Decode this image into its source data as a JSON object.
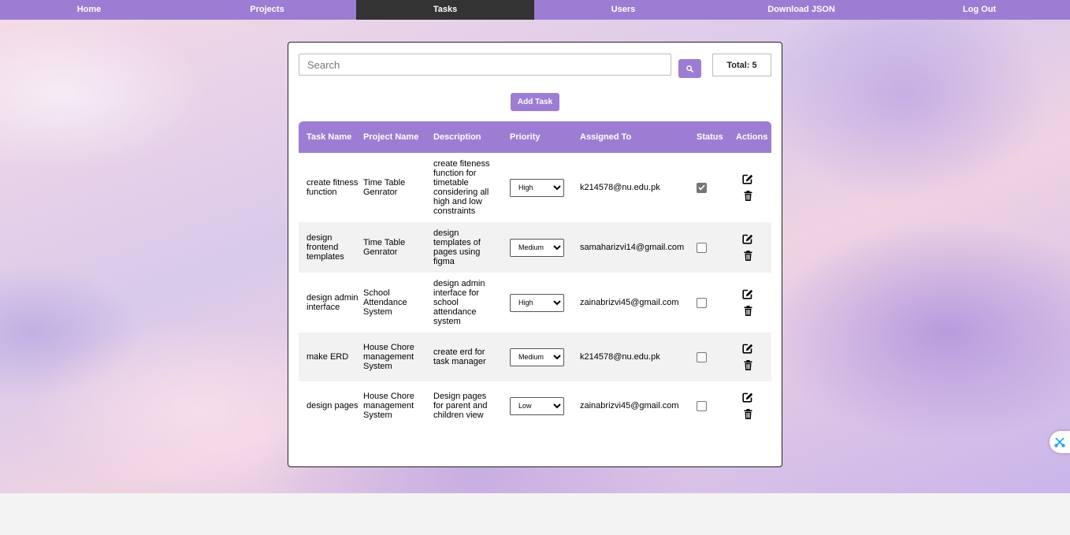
{
  "nav": [
    "Home",
    "Projects",
    "Tasks",
    "Users",
    "Download JSON",
    "Log Out"
  ],
  "nav_active": "Tasks",
  "search": {
    "placeholder": "Search",
    "value": ""
  },
  "total_label": "Total: 5",
  "add_task_label": "Add Task",
  "columns": [
    "Task Name",
    "Project Name",
    "Description",
    "Priority",
    "Assigned To",
    "Status",
    "Actions"
  ],
  "priority_options": [
    "High",
    "Medium",
    "Low"
  ],
  "tasks": [
    {
      "task": "create fitness function",
      "project": "Time Table Genrator",
      "description": "create fiteness function for timetable considering all high and low constraints",
      "priority": "High",
      "assigned": "k214578@nu.edu.pk",
      "done": true
    },
    {
      "task": "design frontend templates",
      "project": "Time Table Genrator",
      "description": "design templates of pages using figma",
      "priority": "Medium",
      "assigned": "samaharizvi14@gmail.com",
      "done": false
    },
    {
      "task": "design admin interface",
      "project": "School Attendance System",
      "description": "design admin interface for school attendance system",
      "priority": "High",
      "assigned": "zainabrizvi45@gmail.com",
      "done": false
    },
    {
      "task": "make ERD",
      "project": "House Chore management System",
      "description": "create erd for task manager",
      "priority": "Medium",
      "assigned": "k214578@nu.edu.pk",
      "done": false
    },
    {
      "task": "design pages",
      "project": "House Chore management System",
      "description": "Design pages for parent and children view",
      "priority": "Low",
      "assigned": "zainabrizvi45@gmail.com",
      "done": false
    }
  ],
  "icons": {
    "search": "search-icon",
    "edit": "edit-icon",
    "delete": "trash-icon",
    "check": "checkmark-icon",
    "widget": "scissors-icon"
  },
  "colors": {
    "accent": "#9c7dd3",
    "nav_active": "#333333",
    "row_alt": "#f2f2f2"
  }
}
